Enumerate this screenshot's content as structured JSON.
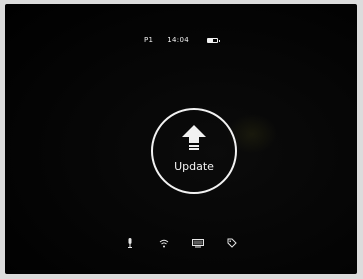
{
  "status_bar": {
    "profile": "P1",
    "time": "14:04",
    "battery_level": 0.6
  },
  "main": {
    "update_label": "Update",
    "update_icon": "upload-arrow-icon"
  },
  "bottom_bar": {
    "icons": [
      "microphone-icon",
      "wifi-icon",
      "monitor-icon",
      "tag-icon"
    ]
  },
  "colors": {
    "background": "#000000",
    "foreground": "#f2f2f2"
  }
}
